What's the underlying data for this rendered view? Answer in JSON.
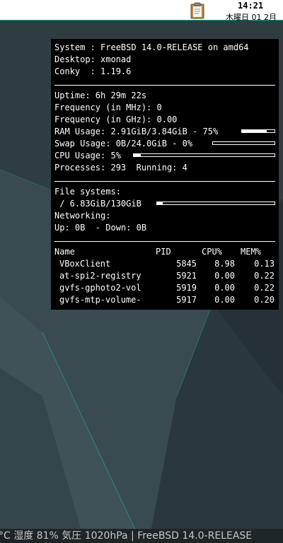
{
  "taskbar": {
    "time": "14:21",
    "date": "木曜日 01 2月"
  },
  "conky": {
    "system_line": "System : FreeBSD 14.0-RELEASE on amd64",
    "desktop_line": "Desktop: xmonad",
    "conky_line": "Conky  : 1.19.6",
    "uptime_line": "Uptime: 6h 29m 22s",
    "freq_mhz_line": "Frequency (in MHz): 0",
    "freq_ghz_line": "Frequency (in GHz): 0.00",
    "ram_line": "RAM Usage: 2.91GiB/3.84GiB - 75%",
    "ram_percent": 75,
    "swap_line": "Swap Usage: 0B/24.0GiB - 0%",
    "swap_percent": 0,
    "cpu_line": "CPU Usage: 5%",
    "cpu_percent": 5,
    "processes_line": "Processes: 293  Running: 4",
    "fs_header": "File systems:",
    "fs_line": " / 6.83GiB/130GiB",
    "fs_percent": 5,
    "net_header": "Networking:",
    "net_line": "Up: 0B  - Down: 0B",
    "table": {
      "headers": [
        "Name",
        "PID",
        "CPU%",
        "MEM%"
      ],
      "rows": [
        [
          "VBoxClient",
          "5845",
          "8.98",
          "0.13"
        ],
        [
          "at-spi2-registry",
          "5921",
          "0.00",
          "0.22"
        ],
        [
          "gvfs-gphoto2-vol",
          "5919",
          "0.00",
          "0.22"
        ],
        [
          "gvfs-mtp-volume-",
          "5917",
          "0.00",
          "0.20"
        ]
      ]
    }
  },
  "statusbar": {
    "text": "°C 湿度 81% 気圧 1020hPa | FreeBSD 14.0-RELEASE"
  }
}
